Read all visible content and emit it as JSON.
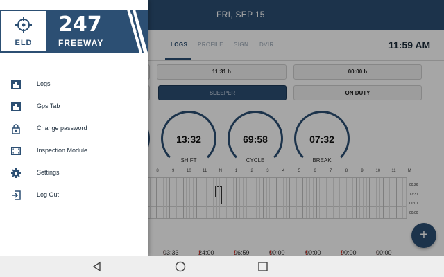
{
  "header": {
    "date": "FRI, SEP 15",
    "time": "11:59 AM"
  },
  "tabs": [
    "LOGS",
    "PROFILE",
    "SIGN",
    "DVIR"
  ],
  "time_boxes": [
    "11:31 h",
    "00:00 h"
  ],
  "status_buttons": {
    "sleeper": "SLEEPER",
    "on_duty": "ON DUTY"
  },
  "gauges": [
    {
      "value": "13:32",
      "label": "SHIFT"
    },
    {
      "value": "69:58",
      "label": "CYCLE"
    },
    {
      "value": "07:32",
      "label": "BREAK"
    }
  ],
  "hour_labels": [
    "8",
    "9",
    "10",
    "11",
    "N",
    "1",
    "2",
    "3",
    "4",
    "5",
    "6",
    "7",
    "8",
    "9",
    "10",
    "11",
    "M"
  ],
  "row_totals": [
    "00:26",
    "17:31",
    "00:01",
    "00:00"
  ],
  "bottom_values": [
    "03:33",
    "24:00",
    "06:59",
    "00:00",
    "00:00",
    "00:00",
    "00:00"
  ],
  "fab_label": "+",
  "logo": {
    "eld": "ELD",
    "number": "247",
    "word": "FREEWAY"
  },
  "menu": [
    {
      "label": "Logs",
      "icon": "bar-chart-icon"
    },
    {
      "label": "Gps Tab",
      "icon": "bar-chart-icon"
    },
    {
      "label": "Change password",
      "icon": "lock-icon"
    },
    {
      "label": "Inspection Module",
      "icon": "scan-frame-icon"
    },
    {
      "label": "Settings",
      "icon": "gear-icon"
    },
    {
      "label": "Log Out",
      "icon": "logout-icon"
    }
  ],
  "system_nav": [
    "back-icon",
    "home-icon",
    "recents-icon"
  ],
  "colors": {
    "brand": "#2c4f73",
    "flag": "#d9362b"
  }
}
